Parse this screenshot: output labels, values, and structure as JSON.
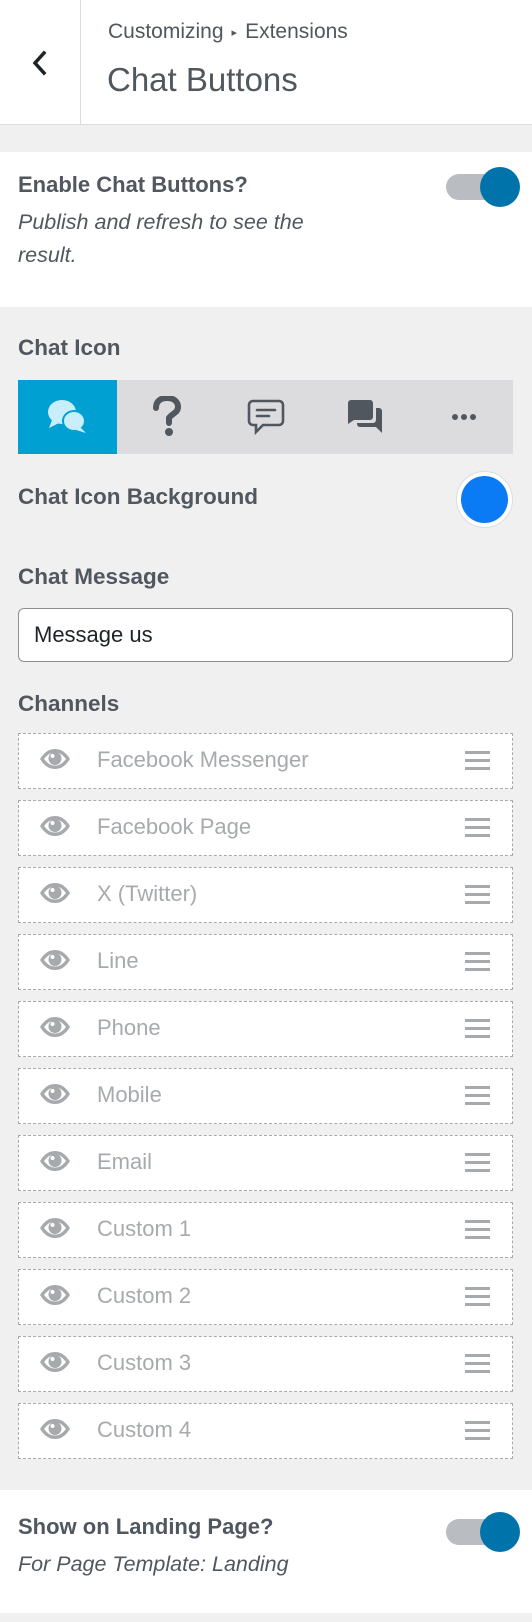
{
  "header": {
    "breadcrumb_root": "Customizing",
    "breadcrumb_sep": "▸",
    "breadcrumb_parent": "Extensions",
    "title": "Chat Buttons"
  },
  "enable": {
    "label": "Enable Chat Buttons?",
    "description": "Publish and refresh to see the result.",
    "enabled": true
  },
  "chat_icon": {
    "label": "Chat Icon",
    "options": [
      {
        "icon": "chat-bubbles-icon",
        "selected": true
      },
      {
        "icon": "question-mark-icon",
        "selected": false
      },
      {
        "icon": "comment-lines-icon",
        "selected": false
      },
      {
        "icon": "conversation-icon",
        "selected": false
      },
      {
        "icon": "ellipsis-icon",
        "selected": false
      }
    ]
  },
  "chat_icon_background": {
    "label": "Chat Icon Background",
    "color": "#0a7bf5"
  },
  "chat_message": {
    "label": "Chat Message",
    "value": "Message us"
  },
  "channels": {
    "label": "Channels",
    "items": [
      {
        "name": "Facebook Messenger",
        "visible": false
      },
      {
        "name": "Facebook Page",
        "visible": false
      },
      {
        "name": "X (Twitter)",
        "visible": false
      },
      {
        "name": "Line",
        "visible": false
      },
      {
        "name": "Phone",
        "visible": false
      },
      {
        "name": "Mobile",
        "visible": false
      },
      {
        "name": "Email",
        "visible": false
      },
      {
        "name": "Custom 1",
        "visible": false
      },
      {
        "name": "Custom 2",
        "visible": false
      },
      {
        "name": "Custom 3",
        "visible": false
      },
      {
        "name": "Custom 4",
        "visible": false
      }
    ]
  },
  "landing": {
    "label": "Show on Landing Page?",
    "description": "For Page Template: Landing",
    "enabled": true
  },
  "colors": {
    "accent": "#0073aa",
    "selected_icon_bg": "#00a0d2",
    "toggle_track": "#b9bcc1"
  }
}
